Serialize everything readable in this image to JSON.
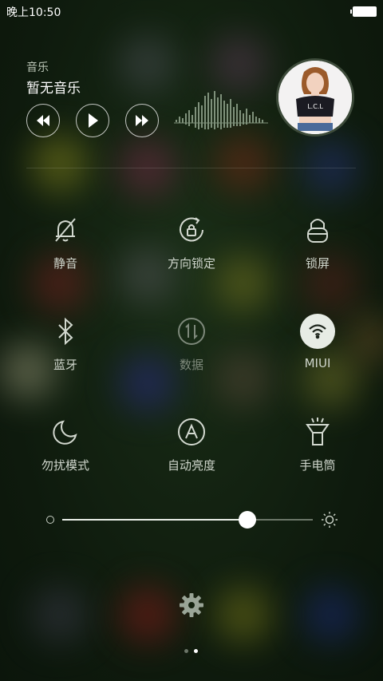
{
  "status": {
    "time": "晚上10:50"
  },
  "music": {
    "label": "音乐",
    "title": "暂无音乐",
    "cover_text": "L.C.L"
  },
  "toggles": [
    {
      "label": "静音",
      "icon": "bell-off-icon",
      "state": "off"
    },
    {
      "label": "方向锁定",
      "icon": "rotation-lock-icon",
      "state": "off"
    },
    {
      "label": "锁屏",
      "icon": "lock-icon",
      "state": "off"
    },
    {
      "label": "蓝牙",
      "icon": "bluetooth-icon",
      "state": "off"
    },
    {
      "label": "数据",
      "icon": "mobile-data-icon",
      "state": "disabled"
    },
    {
      "label": "MIUI",
      "icon": "wifi-icon",
      "state": "on"
    },
    {
      "label": "勿扰模式",
      "icon": "moon-icon",
      "state": "off"
    },
    {
      "label": "自动亮度",
      "icon": "auto-brightness-icon",
      "state": "off"
    },
    {
      "label": "手电筒",
      "icon": "flashlight-icon",
      "state": "off"
    }
  ],
  "brightness": {
    "level": 0.74
  },
  "pager": {
    "pages": 2,
    "current": 2
  },
  "colors": {
    "accent": "#e7ece5",
    "background": "#0f1d0f"
  }
}
